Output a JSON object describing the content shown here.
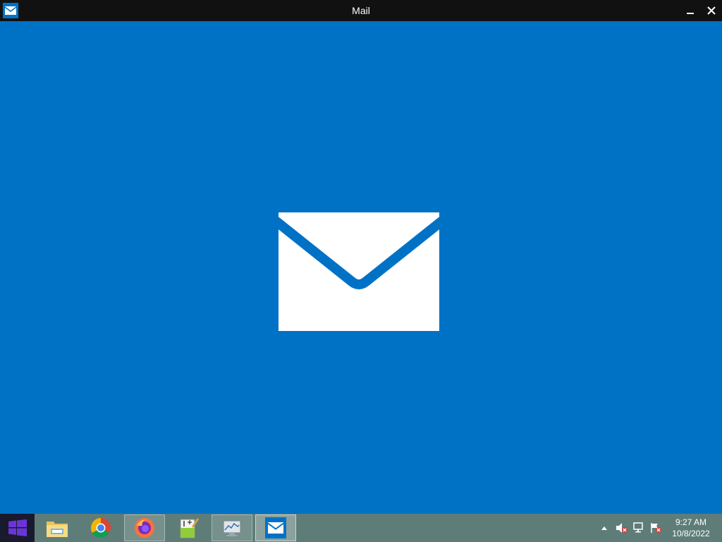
{
  "window": {
    "title": "Mail",
    "app_icon": "mail-icon",
    "minimize_icon": "minimize-icon",
    "close_icon": "close-icon"
  },
  "splash": {
    "logo_icon": "mail-envelope-icon",
    "background_color": "#0072c6",
    "logo_color": "#ffffff"
  },
  "taskbar": {
    "start_icon": "windows-logo-icon",
    "apps": [
      {
        "name": "File Explorer",
        "icon": "folder-icon",
        "state": "pinned"
      },
      {
        "name": "Google Chrome",
        "icon": "chrome-icon",
        "state": "pinned"
      },
      {
        "name": "Firefox",
        "icon": "firefox-icon",
        "state": "running"
      },
      {
        "name": "Notepad++",
        "icon": "notepad-plus-plus-icon",
        "state": "pinned"
      },
      {
        "name": "Resource Monitor",
        "icon": "monitor-icon",
        "state": "running"
      },
      {
        "name": "Mail",
        "icon": "mail-icon",
        "state": "active"
      }
    ],
    "tray": {
      "chevron_icon": "show-hidden-icons-icon",
      "volume_icon": "volume-muted-icon",
      "network_icon": "network-icon",
      "flag_icon": "action-center-flag-icon"
    },
    "clock": {
      "time": "9:27 AM",
      "date": "10/8/2022"
    }
  },
  "colors": {
    "accent": "#0072c6",
    "titlebar": "#111111",
    "taskbar": "#5f7d78"
  }
}
